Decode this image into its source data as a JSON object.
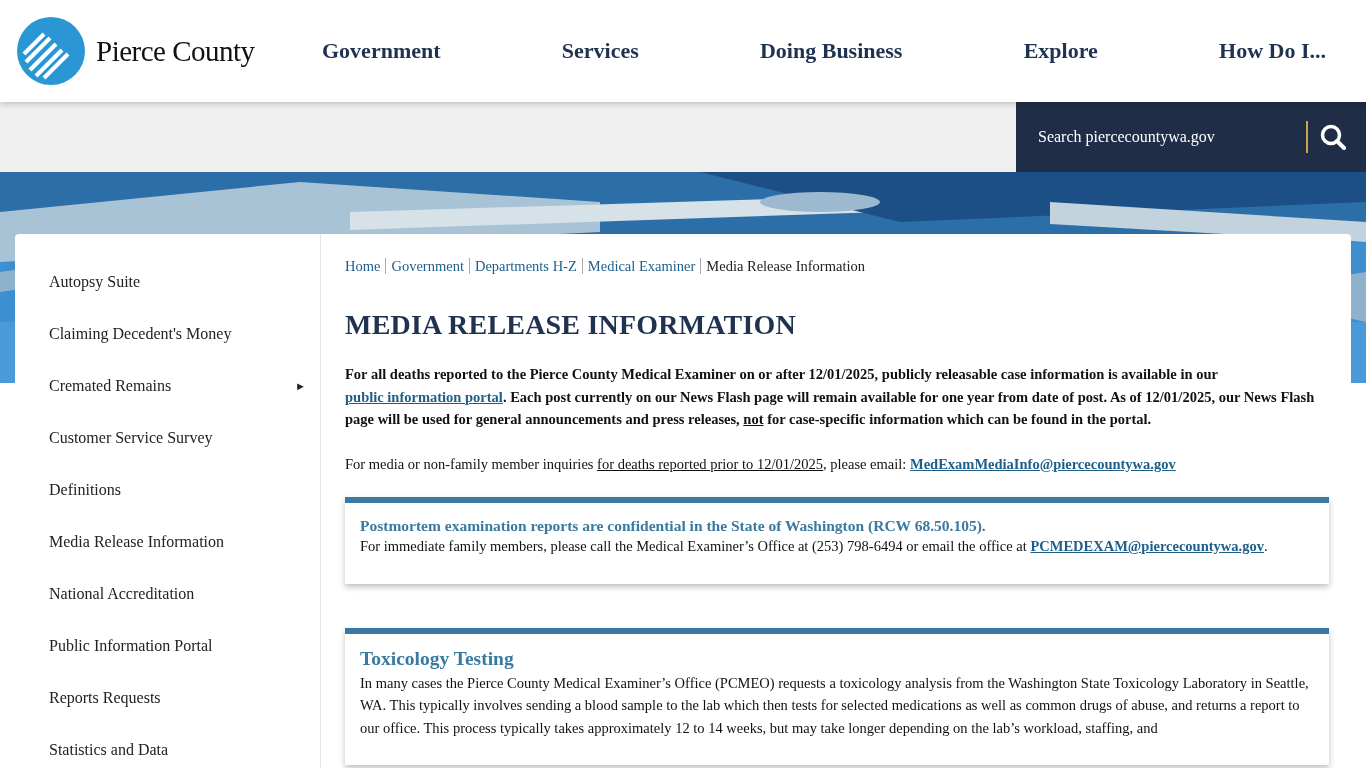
{
  "header": {
    "logo_text": "Pierce County",
    "nav": [
      {
        "label": "Government"
      },
      {
        "label": "Services"
      },
      {
        "label": "Doing Business"
      },
      {
        "label": "Explore"
      },
      {
        "label": "How Do I..."
      }
    ]
  },
  "search": {
    "placeholder": "Search piercecountywa.gov"
  },
  "sidebar": {
    "items": [
      {
        "label": "Autopsy Suite"
      },
      {
        "label": "Claiming Decedent's Money"
      },
      {
        "label": "Cremated Remains",
        "arrow": "►"
      },
      {
        "label": "Customer Service Survey"
      },
      {
        "label": "Definitions"
      },
      {
        "label": "Media Release Information"
      },
      {
        "label": "National Accreditation"
      },
      {
        "label": "Public Information Portal"
      },
      {
        "label": "Reports Requests"
      },
      {
        "label": "Statistics and Data"
      }
    ]
  },
  "breadcrumb": [
    {
      "label": "Home",
      "current": false
    },
    {
      "label": "Government",
      "current": false
    },
    {
      "label": "Departments H-Z",
      "current": false
    },
    {
      "label": "Medical Examiner",
      "current": false
    },
    {
      "label": "Media Release Information",
      "current": true
    }
  ],
  "page_title": "MEDIA RELEASE INFORMATION",
  "paragraphs": [
    {
      "bold": true,
      "parts": [
        {
          "kind": "text",
          "text": "For all deaths reported to the Pierce County Medical Examiner on or after 12/01/2025, publicly releasable case information is available in our "
        },
        {
          "kind": "link",
          "text": "public information portal"
        },
        {
          "kind": "text",
          "text": ".  Each post currently on our News Flash page will remain available for one year from date of post.  As of 12/01/2025, our News Flash page will be used for general announcements and press releases, "
        },
        {
          "kind": "underline",
          "text": "not"
        },
        {
          "kind": "text",
          "text": " for case-specific information which can be found in the portal."
        }
      ]
    },
    {
      "bold": false,
      "parts": [
        {
          "kind": "text",
          "text": "For media or non-family member inquiries "
        },
        {
          "kind": "underline",
          "text": "for deaths reported prior to 12/01/2025"
        },
        {
          "kind": "text",
          "text": ", please email: "
        },
        {
          "kind": "link",
          "text": "MedExamMediaInfo@piercecountywa.gov"
        }
      ]
    }
  ],
  "callouts": [
    {
      "heading": "Postmortem examination reports are confidential in the State of Washington (RCW 68.50.105).",
      "kind": "alert",
      "parts": [
        {
          "kind": "text",
          "text": "For immediate family members, please call the Medical Examiner’s Office at (253) 798-6494 or email the office at "
        },
        {
          "kind": "link",
          "text": "PCMEDEXAM@piercecountywa.gov"
        },
        {
          "kind": "text",
          "text": "."
        }
      ]
    },
    {
      "heading": "Toxicology Testing",
      "kind": "section",
      "parts": [
        {
          "kind": "text",
          "text": "In many cases the Pierce County Medical Examiner’s Office (PCMEO) requests a toxicology analysis from the Washington State Toxicology Laboratory in Seattle, WA.  This typically involves sending a blood sample to the lab which then tests for selected medications as well as common drugs of abuse, and returns a report to our office.  This process typically takes approximately 12 to 14 weeks, but may take longer depending on the lab’s workload, staffing, and"
        }
      ]
    }
  ]
}
